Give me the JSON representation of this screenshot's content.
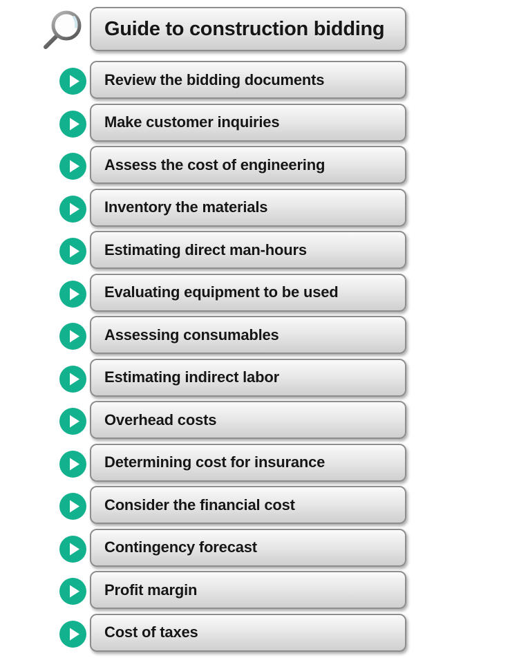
{
  "header": {
    "icon": "magnifier-icon",
    "title": "Guide to construction bidding"
  },
  "colors": {
    "bullet_green": "#11b28d",
    "button_border": "#8d8d8d",
    "button_face_top": "#fbfbfb",
    "button_face_bottom": "#cfcfcf",
    "text": "#161616"
  },
  "steps": [
    {
      "icon": "play-circle-icon",
      "label": "Review the bidding documents"
    },
    {
      "icon": "play-circle-icon",
      "label": "Make customer inquiries"
    },
    {
      "icon": "play-circle-icon",
      "label": "Assess the cost of engineering"
    },
    {
      "icon": "play-circle-icon",
      "label": "Inventory the materials"
    },
    {
      "icon": "play-circle-icon",
      "label": "Estimating direct man-hours"
    },
    {
      "icon": "play-circle-icon",
      "label": "Evaluating equipment to be used"
    },
    {
      "icon": "play-circle-icon",
      "label": "Assessing consumables"
    },
    {
      "icon": "play-circle-icon",
      "label": "Estimating indirect labor"
    },
    {
      "icon": "play-circle-icon",
      "label": "Overhead costs"
    },
    {
      "icon": "play-circle-icon",
      "label": "Determining cost for insurance"
    },
    {
      "icon": "play-circle-icon",
      "label": "Consider the financial cost"
    },
    {
      "icon": "play-circle-icon",
      "label": "Contingency forecast"
    },
    {
      "icon": "play-circle-icon",
      "label": "Profit margin"
    },
    {
      "icon": "play-circle-icon",
      "label": "Cost of taxes"
    }
  ]
}
